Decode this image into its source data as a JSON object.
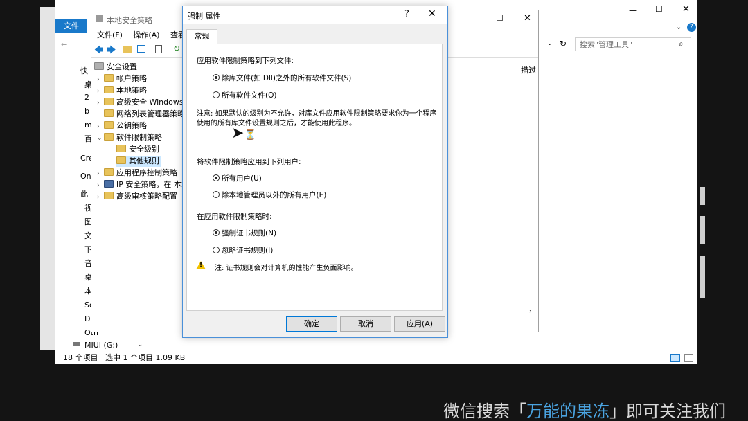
{
  "watermark": {
    "pre": "微信搜索「",
    "highlight": "万能的果冻",
    "post": "」即可关注我们"
  },
  "explorer": {
    "file_tab": "文件",
    "search_placeholder": "搜索\"管理工具\"",
    "nav_items": [
      "快",
      "桌",
      "2",
      "b",
      "m",
      "百",
      "Cre",
      "On",
      "此",
      "视",
      "图",
      "文",
      "下",
      "音",
      "桌",
      "本",
      "Sc",
      "D",
      "Oth",
      "MIUI (G:)"
    ],
    "status_count": "18 个项目",
    "status_selected": "选中 1 个项目  1.09 KB"
  },
  "secpol": {
    "title": "本地安全策略",
    "menu": [
      "文件(F)",
      "操作(A)",
      "查看(V)"
    ],
    "right_header": "描过",
    "tree": [
      "安全设置",
      "帐户策略",
      "本地策略",
      "高级安全 Windows",
      "网络列表管理器策略",
      "公钥策略",
      "软件限制策略",
      "安全级别",
      "其他规则",
      "应用程序控制策略",
      "IP 安全策略，在 本地",
      "高级审核策略配置"
    ]
  },
  "dialog": {
    "title": "强制 属性",
    "help": "?",
    "close": "✕",
    "tab": "常规",
    "section1": "应用软件限制策略到下列文件:",
    "s1_opt1": "除库文件(如 Dll)之外的所有软件文件(S)",
    "s1_opt2": "所有软件文件(O)",
    "note_line1": "注意: 如果默认的级别为不允许，对库文件应用软件限制策略要求你为一个程序",
    "note_line2": "使用的所有库文件设置规则之后，才能使用此程序。",
    "section2": "将软件限制策略应用到下列用户:",
    "s2_opt1": "所有用户(U)",
    "s2_opt2": "除本地管理员以外的所有用户(E)",
    "section3": "在应用软件限制策略时:",
    "s3_opt1": "强制证书规则(N)",
    "s3_opt2": "忽略证书规则(I)",
    "warning": "注: 证书规则会对计算机的性能产生负面影响。",
    "ok": "确定",
    "cancel": "取消",
    "apply": "应用(A)"
  }
}
